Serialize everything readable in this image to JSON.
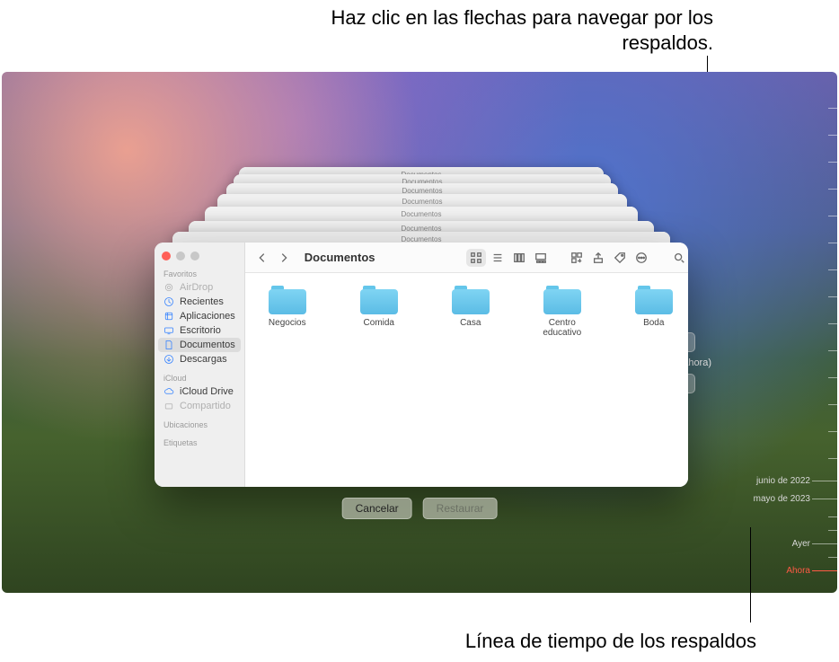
{
  "callouts": {
    "top": "Haz clic en las flechas para navegar por los respaldos.",
    "bottom": "Línea de tiempo de los respaldos"
  },
  "nav": {
    "current_label": "Hoy (ahora)"
  },
  "timeline": {
    "labels": {
      "t1": "junio de 2022",
      "t2": "mayo de 2023",
      "t3": "Ayer",
      "now": "Ahora"
    }
  },
  "actions": {
    "cancel": "Cancelar",
    "restore": "Restaurar"
  },
  "finder": {
    "title": "Documentos",
    "sidebar": {
      "sections": {
        "favorites": "Favoritos",
        "icloud": "iCloud",
        "locations": "Ubicaciones",
        "tags": "Etiquetas"
      },
      "items": {
        "airdrop": "AirDrop",
        "recents": "Recientes",
        "applications": "Aplicaciones",
        "desktop": "Escritorio",
        "documents": "Documentos",
        "downloads": "Descargas",
        "icloud_drive": "iCloud Drive",
        "shared": "Compartido"
      }
    },
    "folders": [
      {
        "name": "Negocios"
      },
      {
        "name": "Comida"
      },
      {
        "name": "Casa"
      },
      {
        "name": "Centro educativo"
      },
      {
        "name": "Boda"
      }
    ]
  },
  "stack_breadcrumb": "Documentos"
}
